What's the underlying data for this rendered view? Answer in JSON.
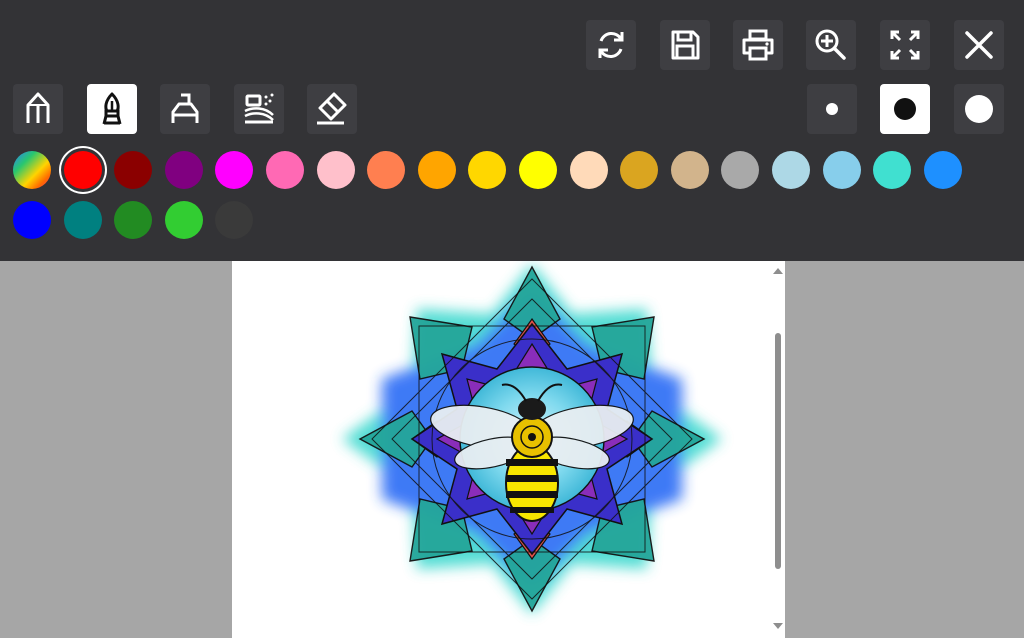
{
  "top_actions": [
    {
      "name": "refresh-button",
      "icon": "refresh-icon"
    },
    {
      "name": "save-button",
      "icon": "save-icon"
    },
    {
      "name": "print-button",
      "icon": "print-icon"
    },
    {
      "name": "zoom-in-button",
      "icon": "zoom-in-icon"
    },
    {
      "name": "fullscreen-button",
      "icon": "fullscreen-icon"
    },
    {
      "name": "close-button",
      "icon": "close-icon"
    }
  ],
  "tools": [
    {
      "name": "pencil-tool",
      "icon": "pencil-icon",
      "active": false
    },
    {
      "name": "brush-tool",
      "icon": "brush-icon",
      "active": true
    },
    {
      "name": "marker-tool",
      "icon": "marker-icon",
      "active": false
    },
    {
      "name": "spray-tool",
      "icon": "spray-icon",
      "active": false
    },
    {
      "name": "eraser-tool",
      "icon": "eraser-icon",
      "active": false
    }
  ],
  "brush_sizes": [
    {
      "name": "small",
      "active": false
    },
    {
      "name": "medium",
      "active": true
    },
    {
      "name": "large",
      "active": false
    }
  ],
  "palette": {
    "selected_index": 1,
    "colors": [
      "rainbow",
      "#ff0000",
      "#8b0000",
      "#800080",
      "#ff00ff",
      "#ff69b4",
      "#ffc0cb",
      "#ff7f50",
      "#ffa500",
      "#ffd700",
      "#ffff00",
      "#ffdab9",
      "#daa520",
      "#d2b48c",
      "#a9a9a9",
      "#add8e6",
      "#87ceeb",
      "#40e0d0",
      "#1e90ff",
      "#0000ff",
      "#008080",
      "#228b22",
      "#32cd32",
      "#3a3a3a"
    ]
  },
  "colors": {
    "toolbar_bg": "#333336",
    "button_bg": "#3e3e42",
    "canvas_bg": "#a6a6a6",
    "page_bg": "#ffffff"
  },
  "artwork": "bee-mandala-coloring-page"
}
